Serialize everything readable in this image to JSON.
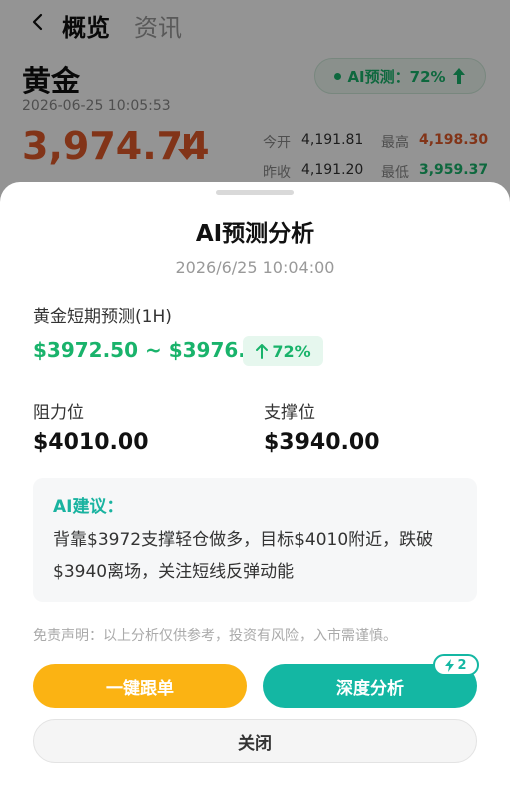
{
  "nav": {
    "tab_overview": "概览",
    "tab_news": "资讯"
  },
  "asset": {
    "name": "黄金",
    "timestamp": "2026-06-25 10:05:53",
    "price": "3,974.74",
    "ai_pill": "AI预测：72%"
  },
  "stats": {
    "open_label": "今开",
    "open_value": "4,191.81",
    "high_label": "最高",
    "high_value": "4,198.30",
    "prev_close_label": "昨收",
    "prev_close_value": "4,191.20",
    "low_label": "最低",
    "low_value": "3,959.37"
  },
  "sheet": {
    "title": "AI预测分析",
    "time": "2026/6/25 10:04:00",
    "forecast_label": "黄金短期预测(1H)",
    "forecast_range": "$3972.50 ~ $3976.50",
    "forecast_probability": "72%",
    "resistance_label": "阻力位",
    "resistance_value": "$4010.00",
    "support_label": "支撑位",
    "support_value": "$3940.00",
    "advice_title": "AI建议：",
    "advice_text": "背靠$3972支撑轻仓做多，目标$4010附近，跌破$3940离场，关注短线反弹动能",
    "disclaimer": "免责声明：以上分析仅供参考，投资有风险，入市需谨慎。",
    "follow_button": "一键跟单",
    "deep_button": "深度分析",
    "credits": "2",
    "close_button": "关闭"
  },
  "colors": {
    "up_green": "#19b36b",
    "down_red": "#e05a2a",
    "teal": "#14b7a3",
    "amber": "#fbb313"
  },
  "icons": [
    "back-icon",
    "arrow-up-icon",
    "arrow-down-icon",
    "lightning-icon"
  ]
}
